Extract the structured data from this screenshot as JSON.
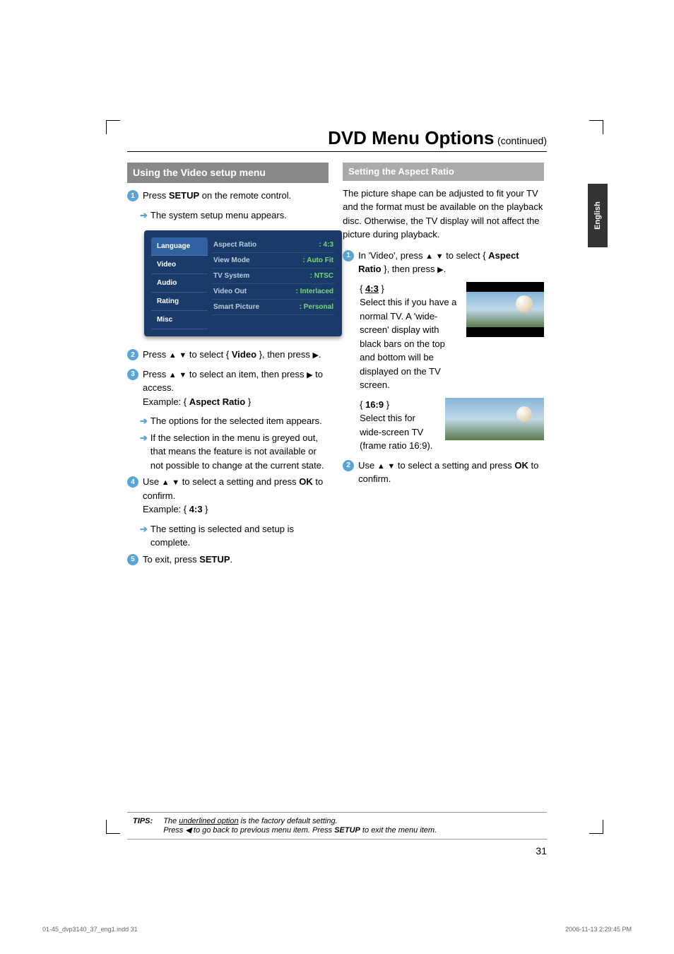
{
  "header": {
    "title": "DVD Menu Options",
    "subtitle": "(continued)"
  },
  "sideTab": "English",
  "left": {
    "sectionTitle": "Using the Video setup menu",
    "step1": {
      "pre": "Press ",
      "bold": "SETUP",
      "post": " on the remote control."
    },
    "step1_sub": "The system setup menu appears.",
    "menu": {
      "tabs": [
        "Language",
        "Video",
        "Audio",
        "Rating",
        "Misc"
      ],
      "items": [
        {
          "k": "Aspect Ratio",
          "v": ": 4:3"
        },
        {
          "k": "View Mode",
          "v": ": Auto Fit"
        },
        {
          "k": "TV System",
          "v": ": NTSC"
        },
        {
          "k": "Video Out",
          "v": ": Interlaced"
        },
        {
          "k": "Smart Picture",
          "v": ": Personal"
        }
      ]
    },
    "step2_a": "Press ",
    "step2_b": " to select { ",
    "step2_bold": "Video",
    "step2_c": " }, then press ",
    "step3_a": "Press ",
    "step3_b": " to select an item, then press ",
    "step3_c": " to access.",
    "step3_ex_a": "Example: { ",
    "step3_ex_bold": "Aspect Ratio",
    "step3_ex_b": " }",
    "step3_sub1": "The options for the selected item appears.",
    "step3_sub2": "If the selection in the menu is greyed out, that means the feature is not available or not possible to change at the current state.",
    "step4_a": "Use ",
    "step4_b": " to select a setting and press ",
    "step4_bold": "OK",
    "step4_c": " to confirm.",
    "step4_ex_a": "Example: { ",
    "step4_ex_bold": "4:3",
    "step4_ex_b": " }",
    "step4_sub": "The setting is selected and setup is complete.",
    "step5_a": "To exit, press ",
    "step5_bold": "SETUP",
    "step5_b": "."
  },
  "right": {
    "sectionTitle": "Setting the Aspect Ratio",
    "intro": "The picture shape can be adjusted to fit your TV and the format must be available on the playback disc. Otherwise, the TV display will not affect the picture during playback.",
    "step1_a": "In 'Video', press ",
    "step1_b": " to select { ",
    "step1_bold1": "Aspect Ratio",
    "step1_c": " }, then press ",
    "step1_d": ".",
    "opt43_label": "4:3",
    "opt43_text": "Select this if you have a normal TV.  A  'wide-screen' display with black bars on the top and bottom will be displayed on the TV screen.",
    "opt169_label": "16:9",
    "opt169_text": "Select this for wide-screen TV (frame ratio 16:9).",
    "step2_a": "Use ",
    "step2_b": " to select a setting and press ",
    "step2_bold": "OK",
    "step2_c": " to confirm."
  },
  "tips": {
    "label": "TIPS:",
    "line1a": "The ",
    "line1u": "underlined option",
    "line1b": " is the factory default setting.",
    "line2a": "Press ",
    "line2b": " to go back to previous menu item. Press ",
    "line2bold": "SETUP",
    "line2c": " to exit the menu item."
  },
  "pageNum": "31",
  "footer": {
    "left": "01-45_dvp3140_37_eng1.indd   31",
    "right": "2006-11-13   2:29:45 PM"
  }
}
